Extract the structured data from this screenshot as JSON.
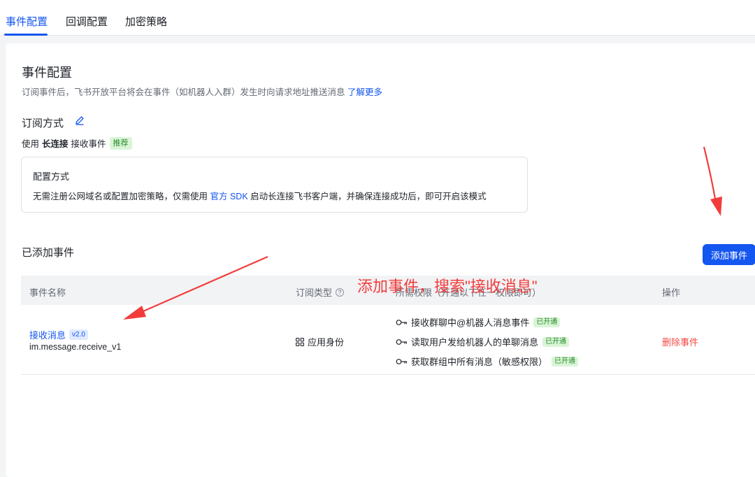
{
  "tabs": [
    {
      "label": "事件配置",
      "active": true
    },
    {
      "label": "回调配置",
      "active": false
    },
    {
      "label": "加密策略",
      "active": false
    }
  ],
  "page": {
    "title": "事件配置",
    "description": "订阅事件后，飞书开放平台将会在事件（如机器人入群）发生时向请求地址推送消息",
    "learn_more": "了解更多"
  },
  "subscription": {
    "title": "订阅方式",
    "method_prefix": "使用",
    "method_bold": "长连接",
    "method_suffix": "接收事件",
    "recommend_tag": "推荐",
    "config_box": {
      "label": "配置方式",
      "text_before": "无需注册公网域名或配置加密策略，仅需使用",
      "sdk_link": "官方 SDK",
      "text_after": "启动长连接飞书客户端，并确保连接成功后，即可开启该模式"
    }
  },
  "events_section": {
    "title": "已添加事件",
    "add_button": "添加事件",
    "columns": [
      "事件名称",
      "订阅类型",
      "所需权限（开通以下任一权限即可）",
      "操作"
    ],
    "rows": [
      {
        "name": "接收消息",
        "version": "v2.0",
        "code": "im.message.receive_v1",
        "sub_type": "应用身份",
        "permissions": [
          {
            "label": "接收群聊中@机器人消息事件",
            "status": "已开通"
          },
          {
            "label": "读取用户发给机器人的单聊消息",
            "status": "已开通"
          },
          {
            "label": "获取群组中所有消息（敏感权限）",
            "status": "已开通"
          }
        ],
        "action": "删除事件"
      }
    ]
  },
  "annotation": {
    "text": "添加事件，搜索\"接收消息\"",
    "color": "#f23c3c"
  },
  "colors": {
    "accent": "#1456f0",
    "danger": "#f54a45",
    "success_bg": "#d9f5d6"
  }
}
